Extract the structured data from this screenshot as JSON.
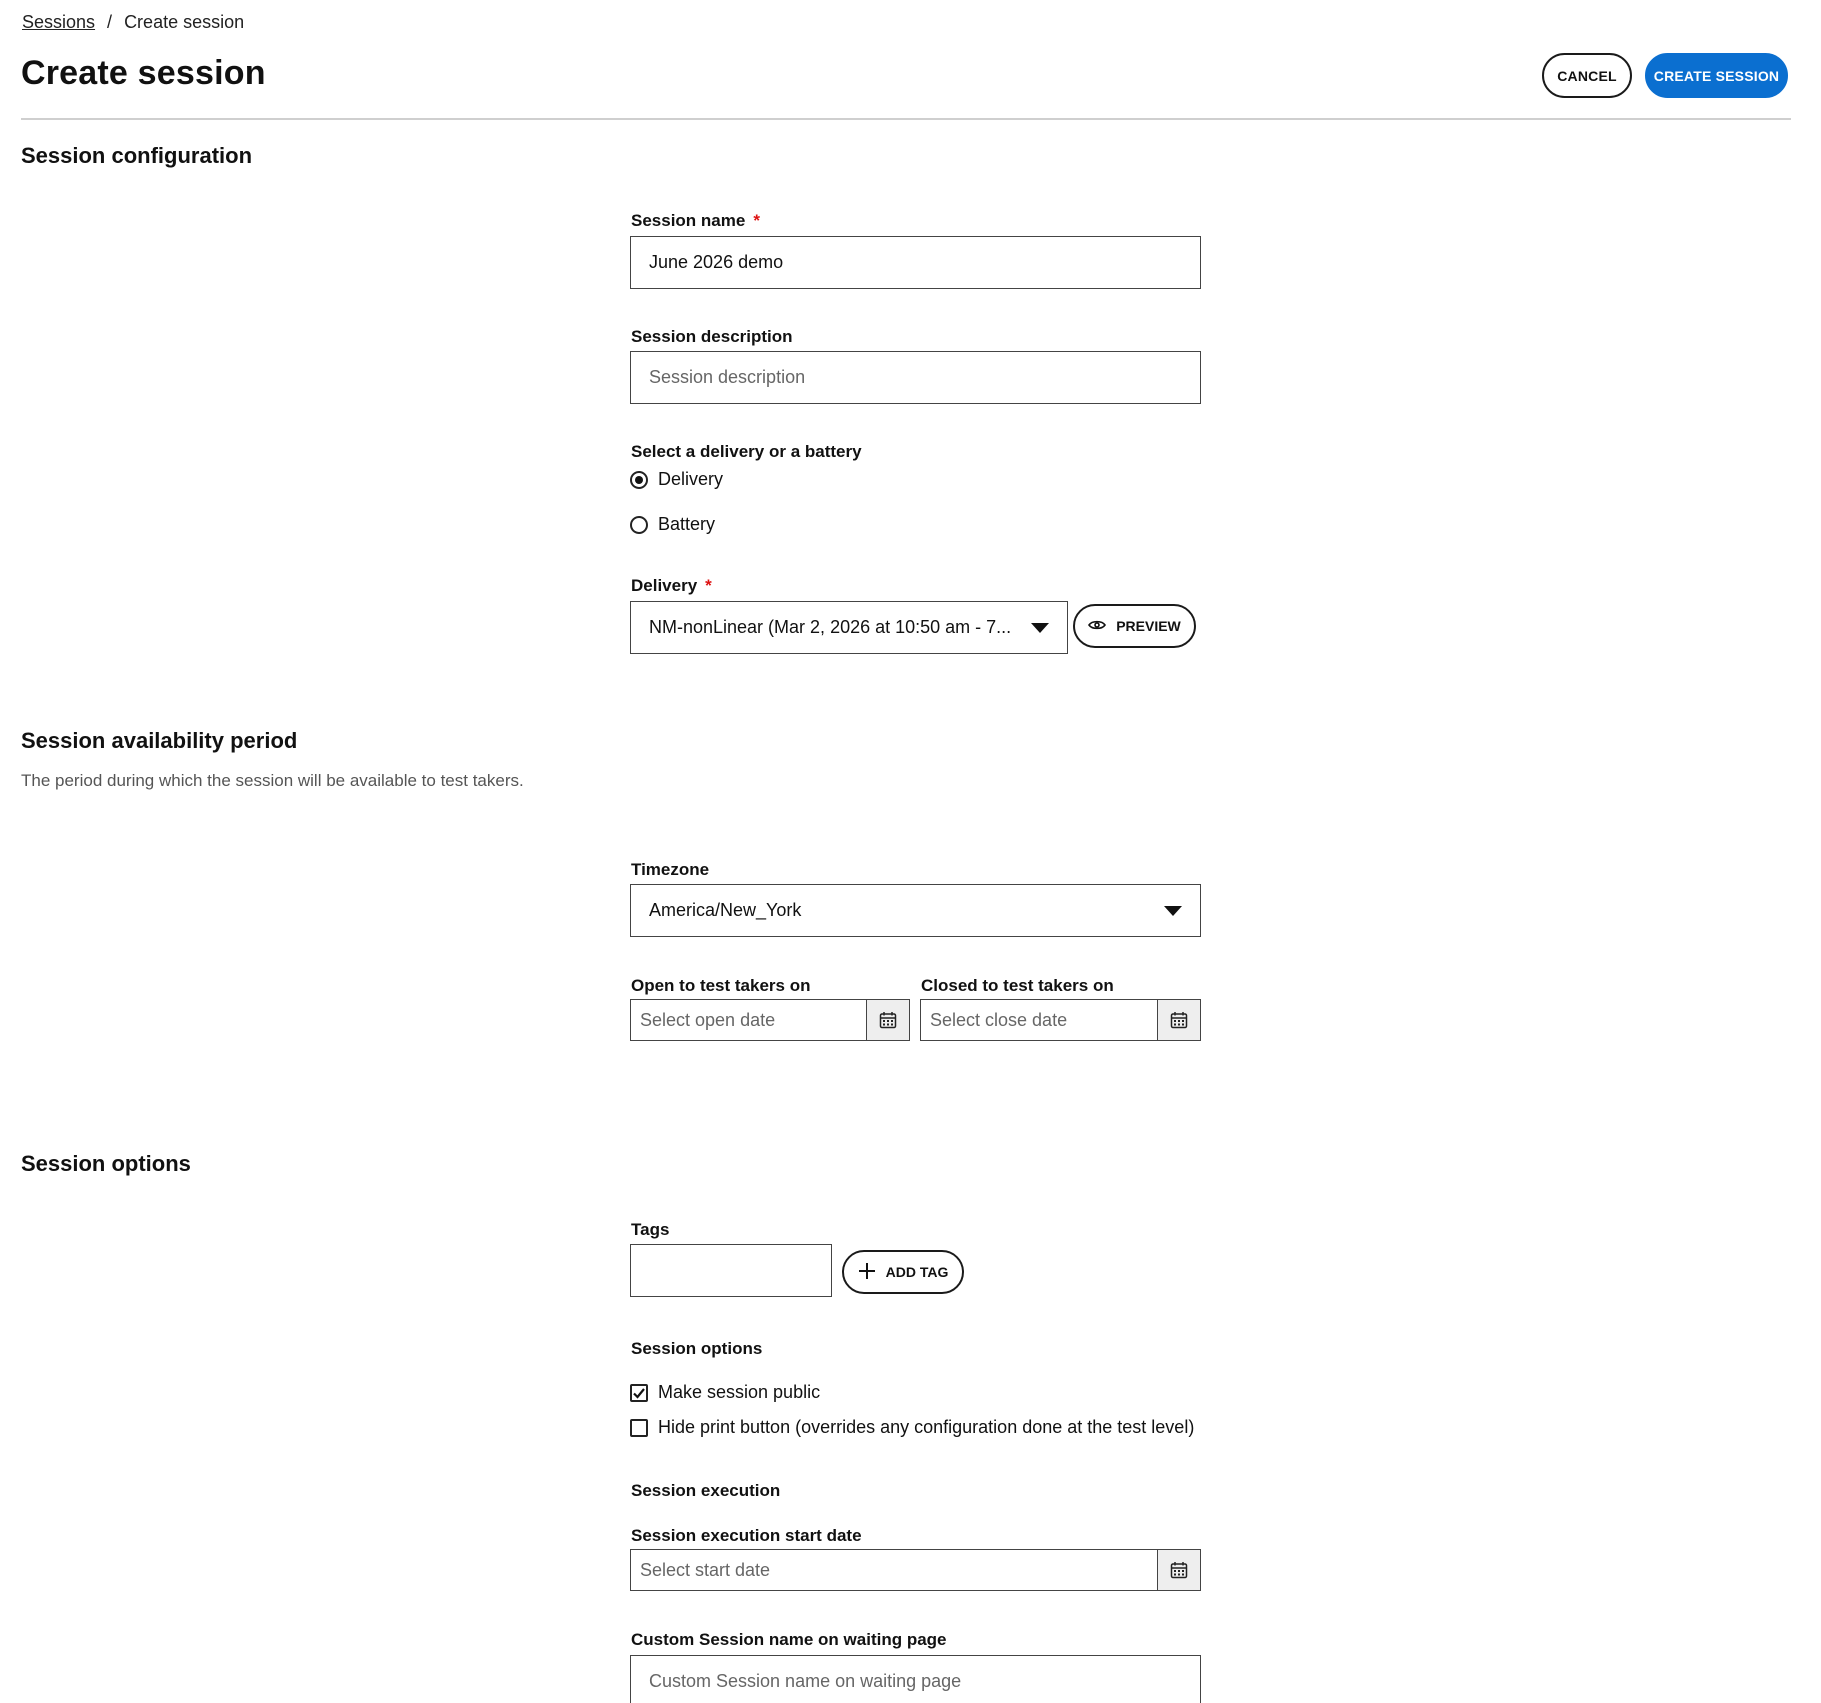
{
  "breadcrumb": {
    "parent": "Sessions",
    "separator": "/",
    "current": "Create session"
  },
  "page": {
    "title": "Create session"
  },
  "actions": {
    "cancel_label": "CANCEL",
    "create_label": "CREATE SESSION"
  },
  "colors": {
    "primary": "#0b6fd0",
    "required": "#dd1111",
    "divider": "#cfcfcf"
  },
  "configuration": {
    "title": "Session configuration",
    "session_name": {
      "label": "Session name",
      "required_mark": "*",
      "value": "June 2026 demo"
    },
    "session_description": {
      "label": "Session description",
      "placeholder": "Session description",
      "value": ""
    },
    "delivery_type": {
      "label": "Select a delivery or a battery",
      "options": [
        {
          "label": "Delivery",
          "selected": true
        },
        {
          "label": "Battery",
          "selected": false
        }
      ]
    },
    "delivery": {
      "label": "Delivery",
      "required_mark": "*",
      "selected": "NM-nonLinear (Mar 2, 2026 at 10:50 am - 7...",
      "preview_label": "PREVIEW"
    }
  },
  "availability": {
    "title": "Session availability period",
    "subtitle": "The period during which the session will be available to test takers.",
    "timezone": {
      "label": "Timezone",
      "selected": "America/New_York"
    },
    "open_date": {
      "label": "Open to test takers on",
      "placeholder": "Select open date"
    },
    "close_date": {
      "label": "Closed to test takers on",
      "placeholder": "Select close date"
    }
  },
  "options": {
    "title": "Session options",
    "tags": {
      "label": "Tags",
      "value": "",
      "add_label": "ADD TAG"
    },
    "session_options": {
      "label": "Session options",
      "items": [
        {
          "label": "Make session public",
          "checked": true
        },
        {
          "label": "Hide print button (overrides any configuration done at the test level)",
          "checked": false
        }
      ]
    },
    "execution": {
      "label": "Session execution",
      "start_date": {
        "label": "Session execution start date",
        "placeholder": "Select start date"
      }
    },
    "custom_name": {
      "label": "Custom Session name on waiting page",
      "placeholder": "Custom Session name on waiting page"
    }
  }
}
